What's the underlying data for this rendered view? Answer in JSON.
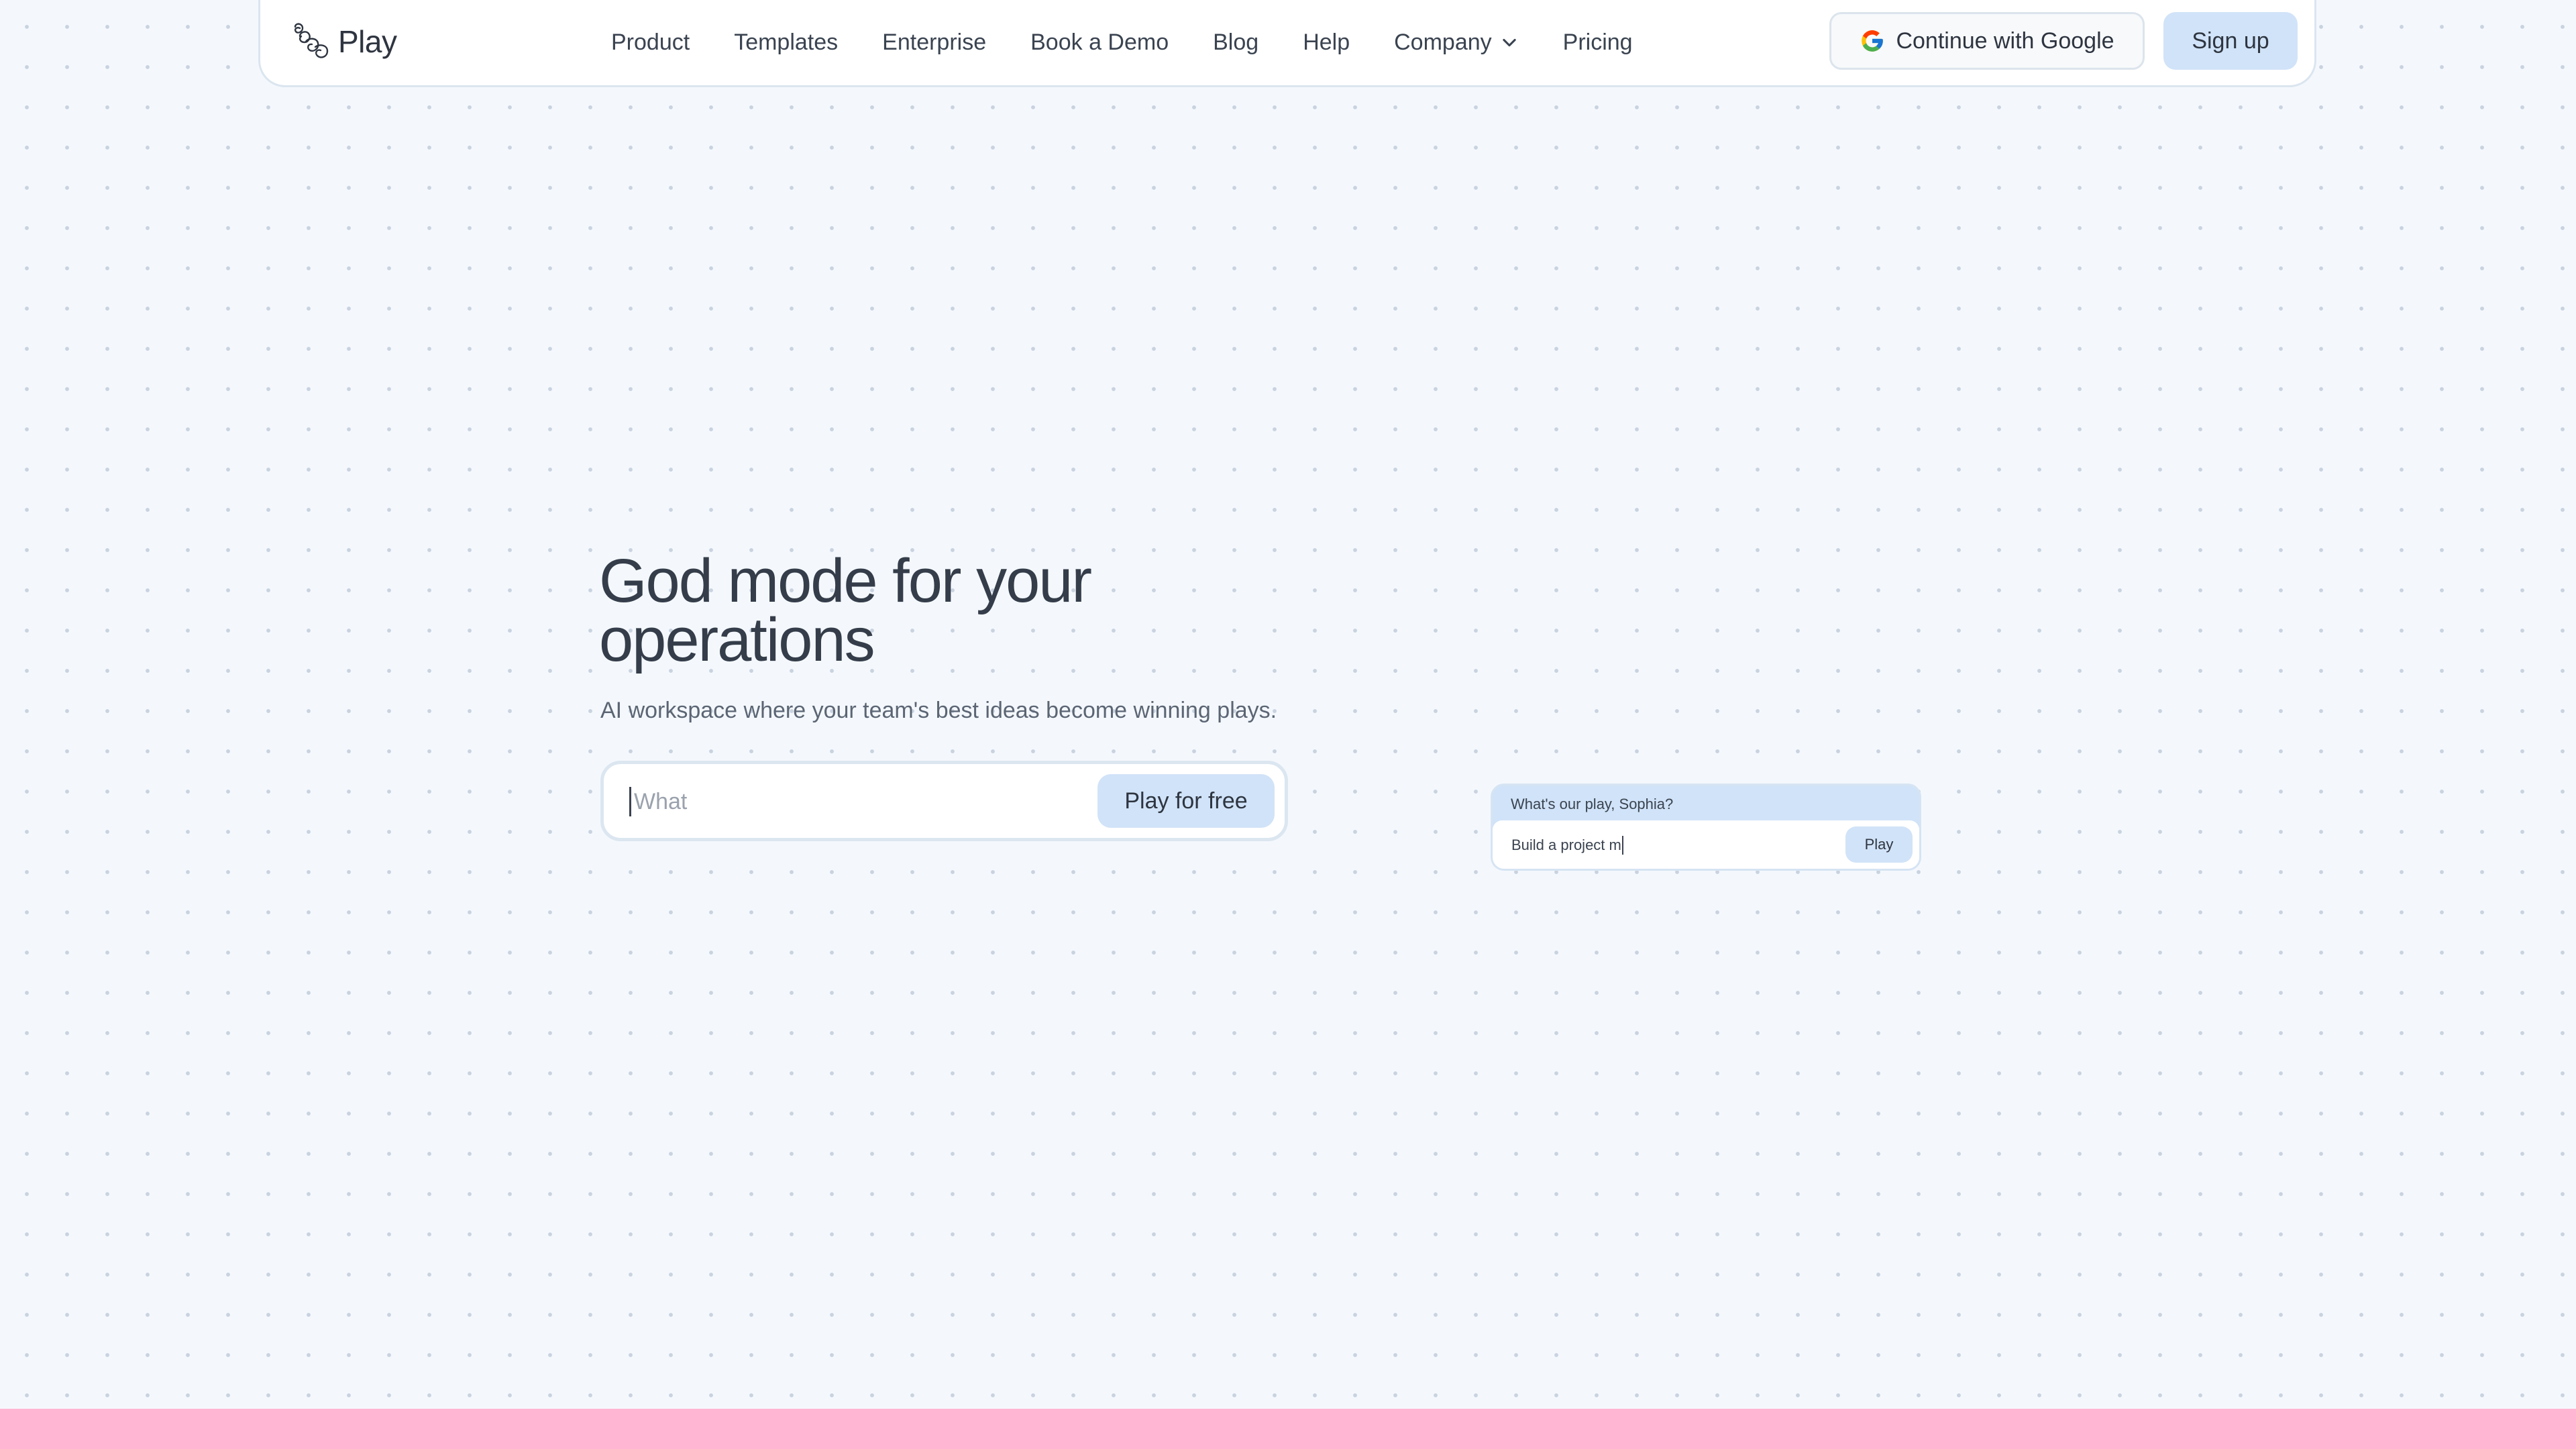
{
  "nav": {
    "logo_text": "Play",
    "links": [
      "Product",
      "Templates",
      "Enterprise",
      "Book a Demo",
      "Blog",
      "Help",
      "Company",
      "Pricing"
    ],
    "google_button": "Continue with Google",
    "signup_button": "Sign up"
  },
  "hero": {
    "title": "God mode for your operations",
    "subtitle": "AI workspace where your team's best ideas become winning plays.",
    "input_placeholder": "What",
    "cta_button": "Play for free"
  },
  "mini_card": {
    "header": "What's our play, Sophia?",
    "input_value": "Build a project m",
    "button": "Play"
  },
  "colors": {
    "background": "#f4f8fd",
    "accent": "#d1e3f8",
    "bottom_band": "#ffb6d3"
  }
}
